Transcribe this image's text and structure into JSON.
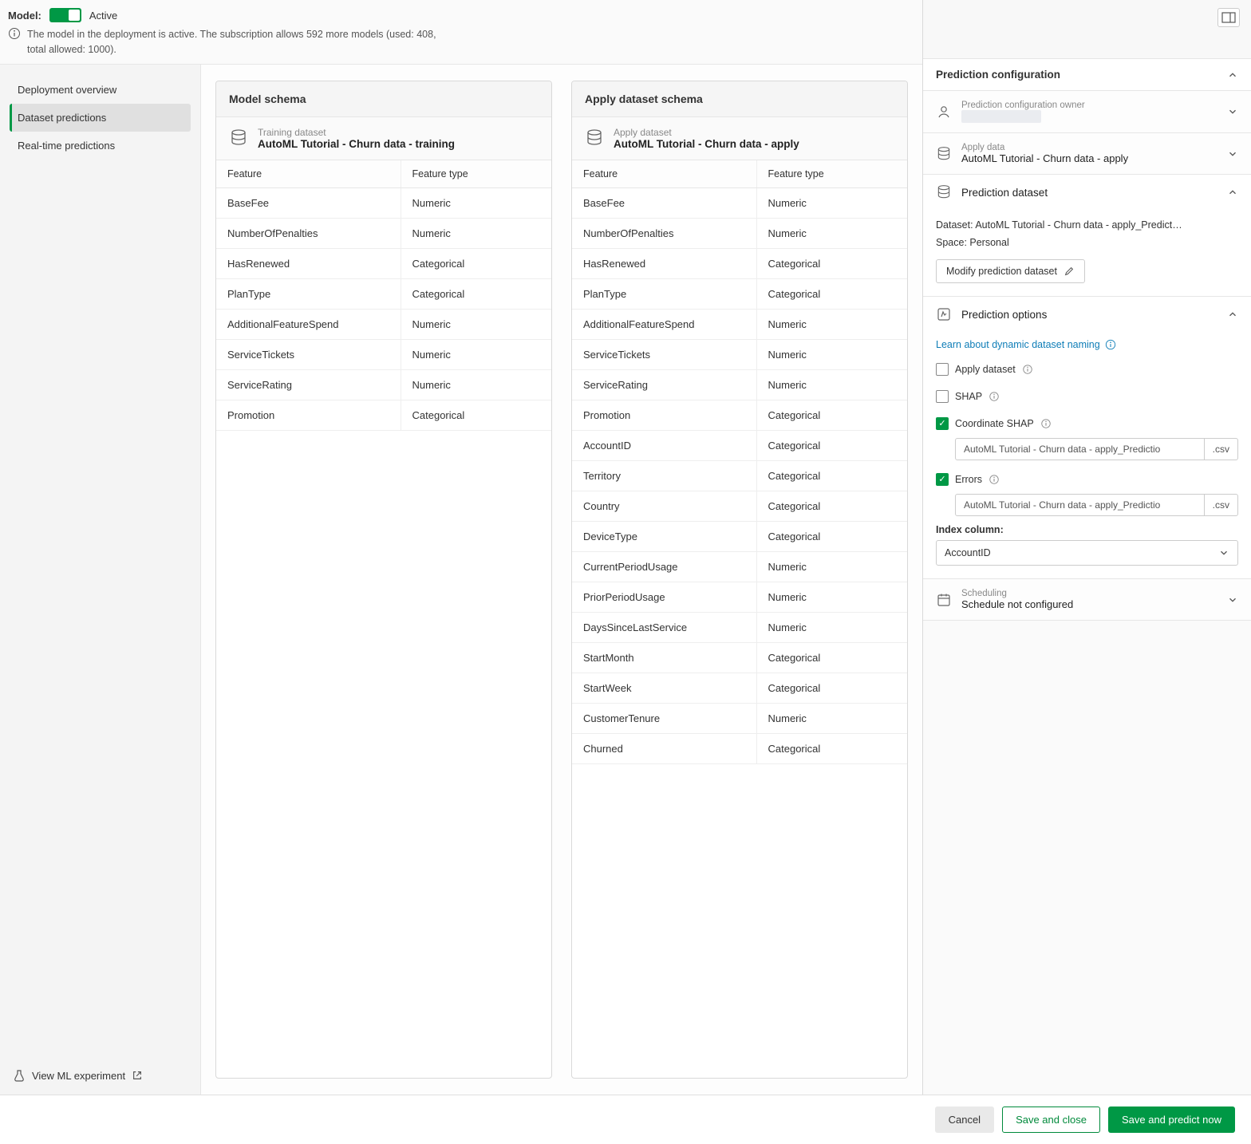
{
  "header": {
    "model_label": "Model:",
    "active_text": "Active",
    "info_text": "The model in the deployment is active. The subscription allows 592 more models (used: 408, total allowed: 1000)."
  },
  "sidebar": {
    "items": [
      {
        "label": "Deployment overview"
      },
      {
        "label": "Dataset predictions"
      },
      {
        "label": "Real-time predictions"
      }
    ],
    "view_experiment": "View ML experiment"
  },
  "model_schema": {
    "title": "Model schema",
    "dataset_label": "Training dataset",
    "dataset_name": "AutoML Tutorial - Churn data - training",
    "col_feature": "Feature",
    "col_type": "Feature type",
    "rows": [
      {
        "f": "BaseFee",
        "t": "Numeric"
      },
      {
        "f": "NumberOfPenalties",
        "t": "Numeric"
      },
      {
        "f": "HasRenewed",
        "t": "Categorical"
      },
      {
        "f": "PlanType",
        "t": "Categorical"
      },
      {
        "f": "AdditionalFeatureSpend",
        "t": "Numeric"
      },
      {
        "f": "ServiceTickets",
        "t": "Numeric"
      },
      {
        "f": "ServiceRating",
        "t": "Numeric"
      },
      {
        "f": "Promotion",
        "t": "Categorical"
      }
    ]
  },
  "apply_schema": {
    "title": "Apply dataset schema",
    "dataset_label": "Apply dataset",
    "dataset_name": "AutoML Tutorial - Churn data - apply",
    "col_feature": "Feature",
    "col_type": "Feature type",
    "rows": [
      {
        "f": "BaseFee",
        "t": "Numeric"
      },
      {
        "f": "NumberOfPenalties",
        "t": "Numeric"
      },
      {
        "f": "HasRenewed",
        "t": "Categorical"
      },
      {
        "f": "PlanType",
        "t": "Categorical"
      },
      {
        "f": "AdditionalFeatureSpend",
        "t": "Numeric"
      },
      {
        "f": "ServiceTickets",
        "t": "Numeric"
      },
      {
        "f": "ServiceRating",
        "t": "Numeric"
      },
      {
        "f": "Promotion",
        "t": "Categorical"
      },
      {
        "f": "AccountID",
        "t": "Categorical"
      },
      {
        "f": "Territory",
        "t": "Categorical"
      },
      {
        "f": "Country",
        "t": "Categorical"
      },
      {
        "f": "DeviceType",
        "t": "Categorical"
      },
      {
        "f": "CurrentPeriodUsage",
        "t": "Numeric"
      },
      {
        "f": "PriorPeriodUsage",
        "t": "Numeric"
      },
      {
        "f": "DaysSinceLastService",
        "t": "Numeric"
      },
      {
        "f": "StartMonth",
        "t": "Categorical"
      },
      {
        "f": "StartWeek",
        "t": "Categorical"
      },
      {
        "f": "CustomerTenure",
        "t": "Numeric"
      },
      {
        "f": "Churned",
        "t": "Categorical"
      }
    ]
  },
  "config": {
    "title": "Prediction configuration",
    "owner_label": "Prediction configuration owner",
    "apply_data_label": "Apply data",
    "apply_data_value": "AutoML Tutorial - Churn data - apply",
    "pred_dataset_title": "Prediction dataset",
    "dataset_line": "Dataset: AutoML Tutorial - Churn data - apply_Predict…",
    "space_line": "Space: Personal",
    "modify_btn": "Modify prediction dataset",
    "options_title": "Prediction options",
    "learn_link": "Learn about dynamic dataset naming",
    "apply_dataset_cb": "Apply dataset",
    "shap_cb": "SHAP",
    "coord_shap_cb": "Coordinate SHAP",
    "errors_cb": "Errors",
    "file_value": "AutoML Tutorial - Churn data - apply_Predictio",
    "file_ext": ".csv",
    "index_label": "Index column:",
    "index_value": "AccountID",
    "scheduling_label": "Scheduling",
    "scheduling_value": "Schedule not configured"
  },
  "footer": {
    "cancel": "Cancel",
    "save_close": "Save and close",
    "save_predict": "Save and predict now"
  }
}
